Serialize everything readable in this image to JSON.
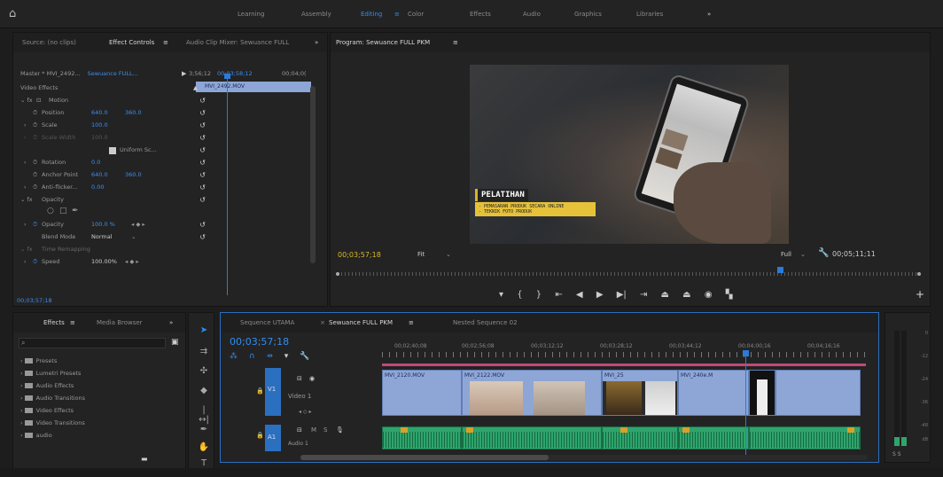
{
  "workspaces": {
    "learning": "Learning",
    "assembly": "Assembly",
    "editing": "Editing",
    "color": "Color",
    "effects": "Effects",
    "audio": "Audio",
    "graphics": "Graphics",
    "libraries": "Libraries",
    "more": "»"
  },
  "source_panel": {
    "tab_source": "Source: (no clips)",
    "tab_effect_controls": "Effect Controls",
    "tab_audio_mixer": "Audio Clip Mixer: Sewuance FULL",
    "more": "»"
  },
  "effect_controls": {
    "master": "Master * MVI_2492...",
    "sequence": "Sewuance FULL...",
    "time1": "3;56;12",
    "time2": "00;03;58;12",
    "time3": "00;04;0(",
    "clip_name": "MVI_2492.MOV",
    "video_effects": "Video Effects",
    "motion": "Motion",
    "position": "Position",
    "position_x": "640.0",
    "position_y": "360.0",
    "scale": "Scale",
    "scale_val": "100.0",
    "scale_width": "Scale Width",
    "scale_width_val": "100.0",
    "uniform": "Uniform Sc...",
    "rotation": "Rotation",
    "rotation_val": "0.0",
    "anchor": "Anchor Point",
    "anchor_x": "640.0",
    "anchor_y": "360.0",
    "antiflicker": "Anti-flicker...",
    "antiflicker_val": "0.00",
    "opacity_group": "Opacity",
    "opacity": "Opacity",
    "opacity_val": "100.0 %",
    "blend": "Blend Mode",
    "blend_val": "Normal",
    "time_remap": "Time Remapping",
    "speed": "Speed",
    "speed_val": "100.00%",
    "timecode": "00;03;57;18"
  },
  "program": {
    "title": "Program: Sewuance FULL PKM",
    "overlay_title": "PELATIHAN",
    "overlay_line1": "- PEMASARAN PRODUK SECARA ONLINE",
    "overlay_line2": "- TEKNIK FOTO PRODUK",
    "timecode": "00;03;57;18",
    "fit": "Fit",
    "quality": "Full",
    "duration": "00;05;11;11"
  },
  "project": {
    "tab_effects": "Effects",
    "tab_media": "Media Browser",
    "more": "»",
    "items": [
      "Presets",
      "Lumetri Presets",
      "Audio Effects",
      "Audio Transitions",
      "Video Effects",
      "Video Transitions",
      "audio"
    ]
  },
  "timeline": {
    "tab1": "Sequence UTAMA",
    "tab2": "Sewuance FULL PKM",
    "tab3": "Nested Sequence 02",
    "timecode": "00;03;57;18",
    "ruler": [
      "00;02;40;08",
      "00;02;56;08",
      "00;03;12;12",
      "00;03;28;12",
      "00;03;44;12",
      "00;04;00;16",
      "00;04;16;16"
    ],
    "v1": "V1",
    "video1": "Video 1",
    "a1": "A1",
    "audio1": "Audio 1",
    "clips": [
      "MVI_2120.MOV",
      "MVI_2122.MOV",
      "MVI_25",
      "MVI_240e.M"
    ]
  },
  "meter": {
    "labels": [
      "0",
      "-12",
      "-24",
      "-36",
      "-48",
      "dB"
    ],
    "solo": "S S"
  },
  "colors": {
    "accent": "#2e8ef2",
    "playhead": "#2b7bd8",
    "clip_video": "#8ea6d6",
    "clip_audio": "#2fa56d"
  }
}
